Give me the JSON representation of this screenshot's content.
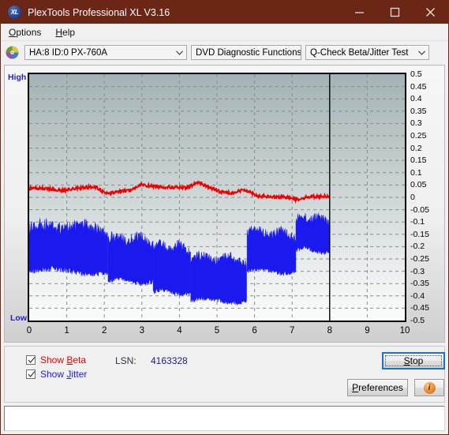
{
  "window": {
    "title": "PlexTools Professional XL V3.16",
    "icon": "XL",
    "app_icon_name": "xl-logo-icon",
    "controls": {
      "minimize": "minimize-icon",
      "maximize": "maximize-icon",
      "close": "close-icon"
    },
    "titlebar_color": "#6b2615"
  },
  "menu": {
    "items": [
      {
        "label": "Options",
        "accel": "O"
      },
      {
        "label": "Help",
        "accel": "H"
      }
    ]
  },
  "toolbar": {
    "disc_icon": "optical-disc-icon",
    "drive_select": {
      "value": "HA:8 ID:0  PX-760A",
      "options": [
        "HA:8 ID:0  PX-760A"
      ]
    },
    "function_select": {
      "value": "DVD Diagnostic Functions",
      "options": [
        "DVD Diagnostic Functions"
      ]
    },
    "test_select": {
      "value": "Q-Check Beta/Jitter Test",
      "options": [
        "Q-Check Beta/Jitter Test"
      ]
    }
  },
  "chart_data": {
    "type": "line",
    "title": "",
    "xlabel": "",
    "ylabel": "",
    "left_axis_top_label": "High",
    "left_axis_bottom_label": "Low",
    "xlim": [
      0,
      10
    ],
    "ylim": [
      -0.5,
      0.5
    ],
    "grid": true,
    "xticks": [
      "0",
      "1",
      "2",
      "3",
      "4",
      "5",
      "6",
      "7",
      "8",
      "9",
      "10"
    ],
    "yticks": [
      "0.5",
      "0.45",
      "0.4",
      "0.35",
      "0.3",
      "0.25",
      "0.2",
      "0.15",
      "0.1",
      "0.05",
      "0",
      "-0.05",
      "-0.1",
      "-0.15",
      "-0.2",
      "-0.25",
      "-0.3",
      "-0.35",
      "-0.4",
      "-0.45",
      "-0.5"
    ],
    "progress_marker_x": 8,
    "series": [
      {
        "name": "Beta",
        "color": "#ee0000",
        "type": "line",
        "x": [
          0.0,
          0.3,
          0.6,
          0.9,
          1.2,
          1.5,
          1.8,
          2.0,
          2.1,
          2.4,
          2.7,
          3.0,
          3.1,
          3.3,
          3.6,
          3.9,
          4.2,
          4.5,
          4.8,
          5.1,
          5.4,
          5.7,
          5.8,
          6.1,
          6.4,
          6.7,
          7.0,
          7.1,
          7.4,
          7.7,
          8.0
        ],
        "values": [
          0.035,
          0.038,
          0.032,
          0.028,
          0.036,
          0.042,
          0.04,
          0.018,
          0.015,
          0.025,
          0.03,
          0.052,
          0.048,
          0.045,
          0.042,
          0.04,
          0.038,
          0.062,
          0.04,
          0.022,
          0.018,
          0.03,
          0.028,
          0.005,
          0.002,
          0.0,
          0.0,
          -0.01,
          0.002,
          0.004,
          0.005
        ]
      },
      {
        "name": "Jitter",
        "color": "#1a1aee",
        "type": "band",
        "segments": [
          {
            "x_start": 0.0,
            "x_end": 2.1,
            "top": -0.135,
            "bottom": -0.3,
            "noise": 0.055
          },
          {
            "x_start": 2.1,
            "x_end": 3.3,
            "top": -0.18,
            "bottom": -0.34,
            "noise": 0.045
          },
          {
            "x_start": 3.3,
            "x_end": 4.3,
            "top": -0.215,
            "bottom": -0.385,
            "noise": 0.045
          },
          {
            "x_start": 4.3,
            "x_end": 5.8,
            "top": -0.26,
            "bottom": -0.42,
            "noise": 0.04
          },
          {
            "x_start": 5.8,
            "x_end": 7.1,
            "top": -0.155,
            "bottom": -0.3,
            "noise": 0.04
          },
          {
            "x_start": 7.1,
            "x_end": 8.0,
            "top": -0.095,
            "bottom": -0.215,
            "noise": 0.04
          }
        ]
      }
    ]
  },
  "controls": {
    "show_beta": {
      "label": "Show Beta",
      "accel": "B",
      "checked": true,
      "color": "#ee0000"
    },
    "show_jitter": {
      "label": "Show Jitter",
      "accel": "J",
      "checked": true,
      "color": "#1a1aee"
    },
    "lsn_label": "LSN:",
    "lsn_value": "4163328",
    "stop_button": {
      "label": "Stop",
      "accel": "S"
    },
    "preferences_button": {
      "label": "Preferences",
      "accel": "P"
    },
    "info_button": {
      "icon": "info-icon",
      "glyph": "i"
    }
  },
  "statusbar": {
    "text": ""
  }
}
